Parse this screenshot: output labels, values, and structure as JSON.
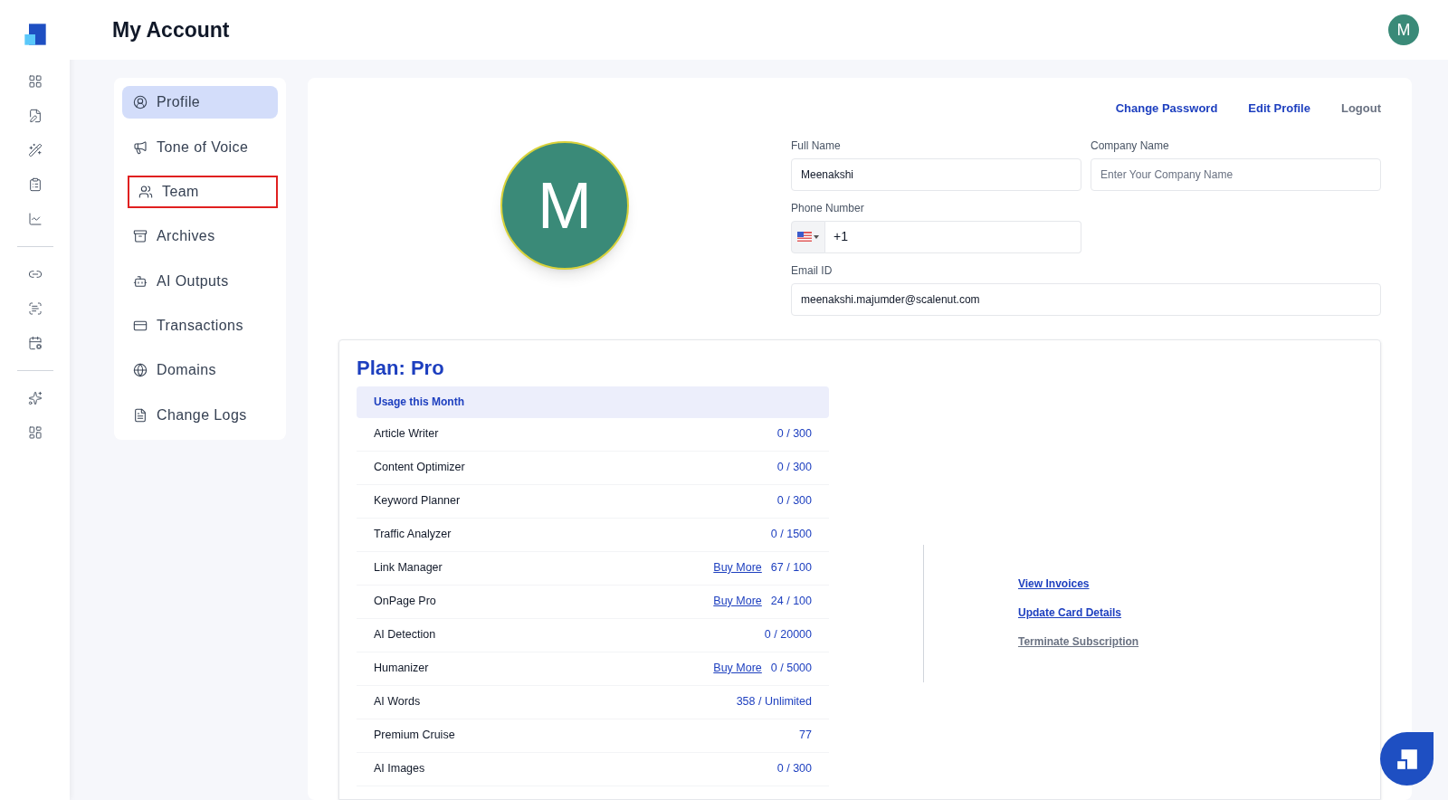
{
  "header": {
    "title": "My Account",
    "avatar_initial": "M"
  },
  "menu": [
    {
      "label": "Profile",
      "selected": true,
      "highlighted": false
    },
    {
      "label": "Tone of Voice",
      "selected": false,
      "highlighted": false
    },
    {
      "label": "Team",
      "selected": false,
      "highlighted": true
    },
    {
      "label": "Archives",
      "selected": false,
      "highlighted": false
    },
    {
      "label": "AI Outputs",
      "selected": false,
      "highlighted": false
    },
    {
      "label": "Transactions",
      "selected": false,
      "highlighted": false
    },
    {
      "label": "Domains",
      "selected": false,
      "highlighted": false
    },
    {
      "label": "Change Logs",
      "selected": false,
      "highlighted": false
    }
  ],
  "profile": {
    "avatar_initial": "M",
    "actions": [
      {
        "label": "Change Password",
        "kind": "primary"
      },
      {
        "label": "Edit Profile",
        "kind": "primary"
      },
      {
        "label": "Logout",
        "kind": "muted"
      }
    ],
    "full_name": {
      "label": "Full Name",
      "value": "Meenakshi"
    },
    "company_name": {
      "label": "Company Name",
      "placeholder": "Enter Your Company Name"
    },
    "phone": {
      "label": "Phone Number",
      "value": "+1"
    },
    "email": {
      "label": "Email ID",
      "value": "meenakshi.majumder@scalenut.com"
    }
  },
  "plan": {
    "title": "Plan: Pro",
    "usage_heading": "Usage this Month",
    "rows": [
      {
        "name": "Article Writer",
        "value": "0 / 300"
      },
      {
        "name": "Content Optimizer",
        "value": "0 / 300"
      },
      {
        "name": "Keyword Planner",
        "value": "0 / 300"
      },
      {
        "name": "Traffic Analyzer",
        "value": "0 / 1500"
      },
      {
        "name": "Link Manager",
        "link": "Buy More",
        "value": "67 / 100"
      },
      {
        "name": "OnPage Pro",
        "link": "Buy More",
        "value": "24 / 100"
      },
      {
        "name": "AI Detection",
        "value": "0 / 20000"
      },
      {
        "name": "Humanizer",
        "link": "Buy More",
        "value": "0 / 5000"
      },
      {
        "name": "AI Words",
        "value": "358 / Unlimited"
      },
      {
        "name": "Premium Cruise",
        "value": "77"
      },
      {
        "name": "AI Images",
        "value": "0 / 300"
      }
    ],
    "links": [
      {
        "label": "View Invoices",
        "kind": "primary"
      },
      {
        "label": "Update Card Details",
        "kind": "primary"
      },
      {
        "label": "Terminate Subscription",
        "kind": "muted"
      }
    ]
  }
}
